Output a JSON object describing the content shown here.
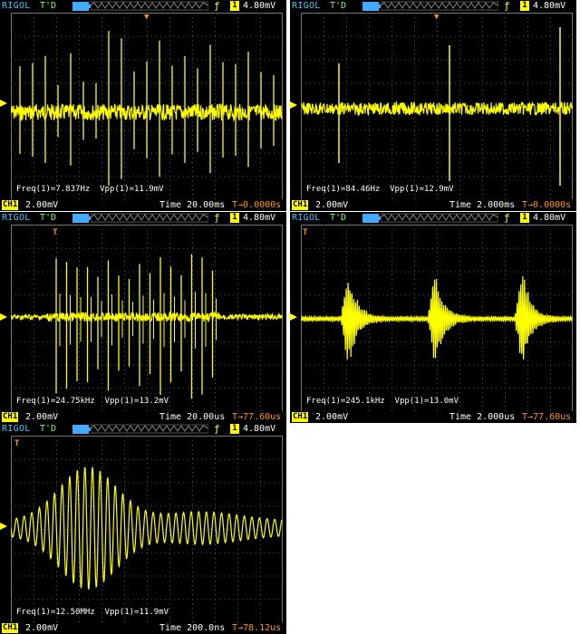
{
  "accent": "#ffff00",
  "scopes": [
    {
      "brand": "RIGOL",
      "status": "T'D",
      "channel_num": "1",
      "trigger_level": "4.80mV",
      "freq": "Freq(1)=7.837Hz",
      "vpp": "Vpp(1)=11.9mV",
      "channel_label": "CH1",
      "volts_div": "2.00mV",
      "time_div": "Time 20.00ms",
      "delay": "T→0.0000s"
    },
    {
      "brand": "RIGOL",
      "status": "T'D",
      "channel_num": "1",
      "trigger_level": "4.80mV",
      "freq": "Freq(1)=84.46Hz",
      "vpp": "Vpp(1)=12.9mV",
      "channel_label": "CH1",
      "volts_div": "2.00mV",
      "time_div": "Time 2.000ms",
      "delay": "T→0.0000s"
    },
    {
      "brand": "RIGOL",
      "status": "T'D",
      "channel_num": "1",
      "trigger_level": "4.80mV",
      "freq": "Freq(1)=24.75kHz",
      "vpp": "Vpp(1)=13.2mV",
      "channel_label": "CH1",
      "volts_div": "2.00mV",
      "time_div": "Time 20.00us",
      "delay": "T→77.60us"
    },
    {
      "brand": "RIGOL",
      "status": "T'D",
      "channel_num": "1",
      "trigger_level": "4.80mV",
      "freq": "Freq(1)=245.1kHz",
      "vpp": "Vpp(1)=13.0mV",
      "channel_label": "CH1",
      "volts_div": "2.00mV",
      "time_div": "Time 2.000us",
      "delay": "T→77.60us"
    },
    {
      "brand": "RIGOL",
      "status": "T'D",
      "channel_num": "1",
      "trigger_level": "4.80mV",
      "freq": "Freq(1)=12.50MHz",
      "vpp": "Vpp(1)=11.9mV",
      "channel_label": "CH1",
      "volts_div": "2.00mV",
      "time_div": "Time 200.0ns",
      "delay": "T→78.12us"
    }
  ]
}
